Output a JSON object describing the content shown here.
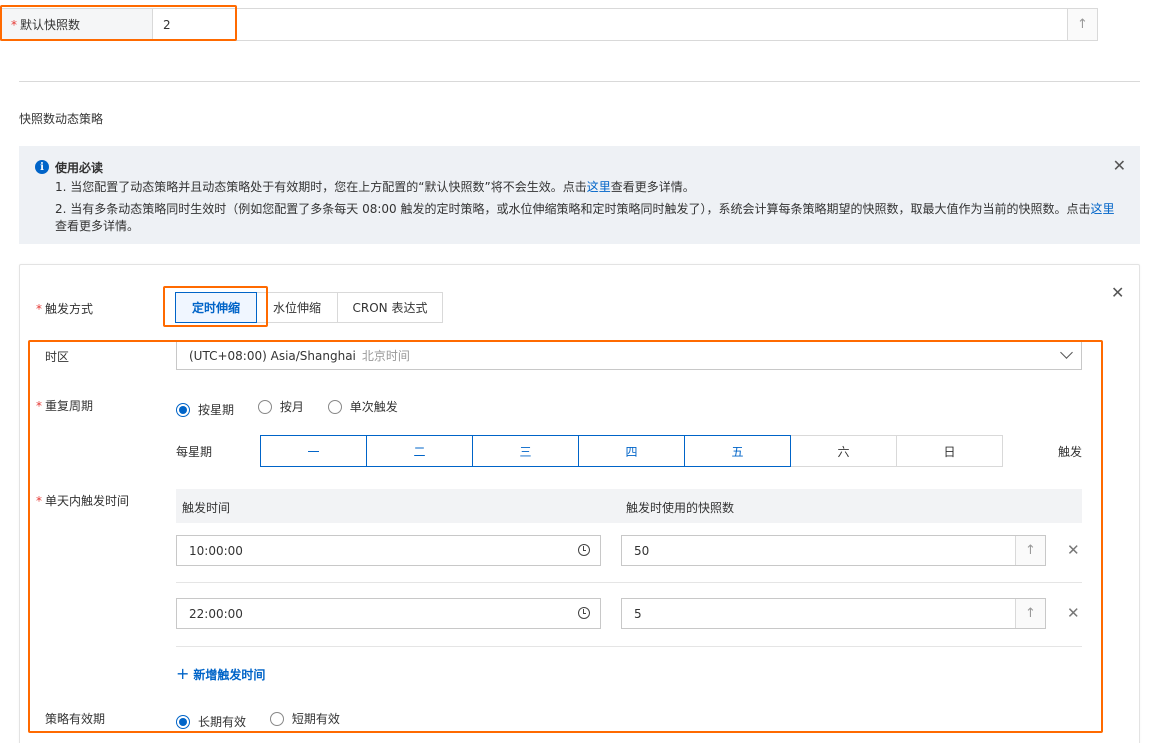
{
  "default_snapshots": {
    "label": "默认快照数",
    "value": "2"
  },
  "section_title": "快照数动态策略",
  "notice": {
    "title": "使用必读",
    "line1_prefix": "1. 当您配置了动态策略并且动态策略处于有效期时，您在上方配置的“默认快照数”将不会生效。点击",
    "line1_link": "这里",
    "line1_suffix": "查看更多详情。",
    "line2_prefix": "2. 当有多条动态策略同时生效时（例如您配置了多条每天 08:00 触发的定时策略，或水位伸缩策略和定时策略同时触发了），系统会计算每条策略期望的快照数，取最大值作为当前的快照数。点击",
    "line2_link": "这里",
    "line2_suffix": "查看更多详情。"
  },
  "trigger": {
    "label": "触发方式",
    "tabs": [
      "定时伸缩",
      "水位伸缩",
      "CRON 表达式"
    ],
    "active_tab": 0
  },
  "timezone": {
    "label": "时区",
    "value": "(UTC+08:00)   Asia/Shanghai",
    "hint": "北京时间"
  },
  "repeat": {
    "label": "重复周期",
    "options": [
      "按星期",
      "按月",
      "单次触发"
    ],
    "selected": 0,
    "weekday_label": "每星期",
    "days": [
      "一",
      "二",
      "三",
      "四",
      "五",
      "六",
      "日"
    ],
    "selected_days": [
      0,
      1,
      2,
      3,
      4
    ],
    "trigger_suffix": "触发"
  },
  "daily_trigger": {
    "label": "单天内触发时间",
    "col_time": "触发时间",
    "col_snapshots": "触发时使用的快照数",
    "rows": [
      {
        "time": "10:00:00",
        "snapshots": "50"
      },
      {
        "time": "22:00:00",
        "snapshots": "5"
      }
    ],
    "add_label": "新增触发时间"
  },
  "validity": {
    "label": "策略有效期",
    "options": [
      "长期有效",
      "短期有效"
    ],
    "selected": 0
  },
  "icons": {
    "stepper": "up-arrow-icon",
    "info": "info-icon",
    "close": "close-icon",
    "clock": "clock-icon",
    "dropdown": "chevron-down-icon",
    "add": "plus-icon"
  },
  "colors": {
    "accent": "#0064c8",
    "highlight": "#ff6a00",
    "required": "#e53935"
  }
}
